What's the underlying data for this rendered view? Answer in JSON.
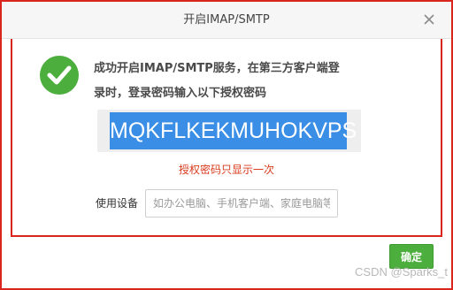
{
  "window": {
    "title": "开启IMAP/SMTP",
    "close_icon": "close-icon"
  },
  "status": {
    "icon": "check-circle-icon",
    "message_line1": "成功开启IMAP/SMTP服务，在第三方客户端登",
    "message_line2": "录时，登录密码输入以下授权密码"
  },
  "auth_code": {
    "value": "MQKFLKEKMUHOKVPS",
    "notice": "授权密码只显示一次"
  },
  "device": {
    "label": "使用设备",
    "placeholder": "如办公电脑、手机客户端、家庭电脑等",
    "value": ""
  },
  "actions": {
    "confirm_label": "确定"
  },
  "watermark": "CSDN @Sparks_t",
  "colors": {
    "accent_red": "#d9261c",
    "success_green": "#4cae3d",
    "code_highlight": "#3a8ee6",
    "notice_red": "#d93a1e"
  }
}
